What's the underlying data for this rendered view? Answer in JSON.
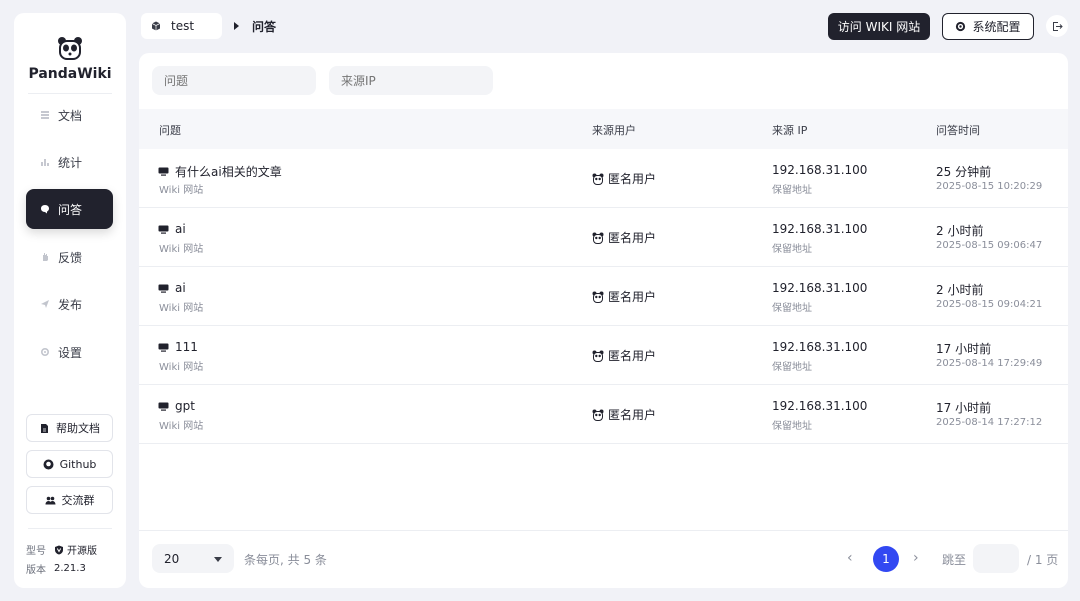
{
  "app": {
    "name": "PandaWiki"
  },
  "sidebar": {
    "items": [
      {
        "label": "文档",
        "icon": "document-icon",
        "active": false
      },
      {
        "label": "统计",
        "icon": "chart-icon",
        "active": false
      },
      {
        "label": "问答",
        "icon": "chat-icon",
        "active": true
      },
      {
        "label": "反馈",
        "icon": "hand-icon",
        "active": false
      },
      {
        "label": "发布",
        "icon": "send-icon",
        "active": false
      },
      {
        "label": "设置",
        "icon": "gear-icon",
        "active": false
      }
    ],
    "links": [
      {
        "label": "帮助文档",
        "icon": "doc-icon"
      },
      {
        "label": "Github",
        "icon": "github-icon"
      },
      {
        "label": "交流群",
        "icon": "group-icon"
      }
    ],
    "edition_label": "型号",
    "edition_value": "开源版",
    "version_label": "版本",
    "version_value": "2.21.3"
  },
  "topbar": {
    "kb_name": "test",
    "current_page": "问答",
    "visit_label": "访问 WIKI 网站",
    "config_label": "系统配置"
  },
  "filters": {
    "question_placeholder": "问题",
    "ip_placeholder": "来源IP"
  },
  "table": {
    "columns": [
      "问题",
      "来源用户",
      "来源 IP",
      "问答时间"
    ],
    "rows": [
      {
        "question": "有什么ai相关的文章",
        "source": "Wiki 网站",
        "user": "匿名用户",
        "ip": "192.168.31.100",
        "ip_note": "保留地址",
        "time_ago": "25 分钟前",
        "time": "2025-08-15 10:20:29"
      },
      {
        "question": "ai",
        "source": "Wiki 网站",
        "user": "匿名用户",
        "ip": "192.168.31.100",
        "ip_note": "保留地址",
        "time_ago": "2 小时前",
        "time": "2025-08-15 09:06:47"
      },
      {
        "question": "ai",
        "source": "Wiki 网站",
        "user": "匿名用户",
        "ip": "192.168.31.100",
        "ip_note": "保留地址",
        "time_ago": "2 小时前",
        "time": "2025-08-15 09:04:21"
      },
      {
        "question": "111",
        "source": "Wiki 网站",
        "user": "匿名用户",
        "ip": "192.168.31.100",
        "ip_note": "保留地址",
        "time_ago": "17 小时前",
        "time": "2025-08-14 17:29:49"
      },
      {
        "question": "gpt",
        "source": "Wiki 网站",
        "user": "匿名用户",
        "ip": "192.168.31.100",
        "ip_note": "保留地址",
        "time_ago": "17 小时前",
        "time": "2025-08-14 17:27:12"
      }
    ]
  },
  "pagination": {
    "page_size": "20",
    "summary": "条每页, 共 5 条",
    "current_page": "1",
    "jump_label": "跳至",
    "total_pages": "/ 1 页"
  },
  "colors": {
    "primary": "#21222d",
    "accent": "#3248f2",
    "background": "#f1f2f7"
  }
}
